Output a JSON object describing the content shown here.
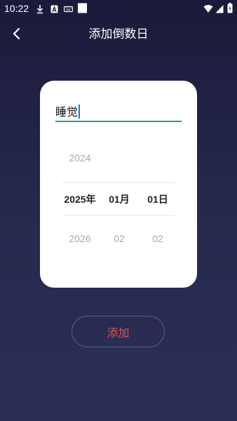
{
  "status_bar": {
    "time": "10:22",
    "icons": [
      "download-icon",
      "a-notification-icon",
      "keyboard-icon",
      "white-square-icon",
      "wifi-icon",
      "signal-icon",
      "battery-icon"
    ]
  },
  "header": {
    "back_icon": "chevron-left-icon",
    "title": "添加倒数日"
  },
  "form": {
    "name_value": "睡觉",
    "picker": {
      "year": {
        "prev": "2024",
        "selected": "2025年",
        "next": "2026"
      },
      "month": {
        "prev": "",
        "selected": "01月",
        "next": "02"
      },
      "day": {
        "prev": "",
        "selected": "01日",
        "next": "02"
      }
    }
  },
  "actions": {
    "add_label": "添加"
  },
  "colors": {
    "background_top": "#1a1a3a",
    "background_bottom": "#2b2f56",
    "card": "#ffffff",
    "input_underline": "#1f9e8a",
    "add_text": "#e8504a",
    "add_border": "#5a5e86"
  }
}
